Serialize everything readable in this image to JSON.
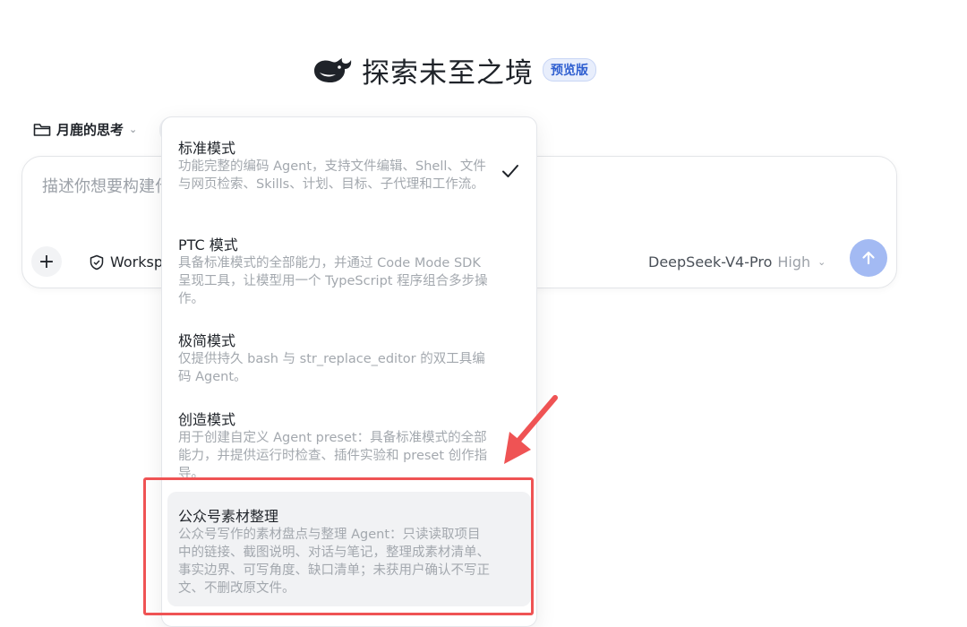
{
  "header": {
    "title": "探索未至之境",
    "badge": "预览版"
  },
  "folder": {
    "label": "月鹿的思考"
  },
  "input": {
    "placeholder": "描述你想要构建什么"
  },
  "toolbar": {
    "workspace_label": "Workspace",
    "model_name": "DeepSeek-V4-Pro",
    "model_level": "High"
  },
  "dropdown": {
    "options": [
      {
        "title": "标准模式",
        "desc": "功能完整的编码 Agent，支持文件编辑、Shell、文件与网页检索、Skills、计划、目标、子代理和工作流。",
        "selected_check": true
      },
      {
        "title": "PTC 模式",
        "desc": "具备标准模式的全部能力，并通过 Code Mode SDK 呈现工具，让模型用一个 TypeScript 程序组合多步操作。"
      },
      {
        "title": "极简模式",
        "desc": "仅提供持久 bash 与 str_replace_editor 的双工具编码 Agent。"
      },
      {
        "title": "创造模式",
        "desc": "用于创建自定义 Agent preset：具备标准模式的全部能力，并提供运行时检查、插件实验和 preset 创作指导。"
      },
      {
        "title": "公众号素材整理",
        "desc": "公众号写作的素材盘点与整理 Agent：只读读取项目中的链接、截图说明、对话与笔记，整理成素材清单、事实边界、可写角度、缺口清单；未获用户确认不写正文、不删改原文件。",
        "hovered": true
      }
    ]
  },
  "colors": {
    "accent": "#a3baf3",
    "annotation": "#ef5354",
    "badge_bg": "#e8eefc",
    "badge_text": "#2f5fd0"
  },
  "icons": [
    "whale-logo-icon",
    "folder-icon",
    "chevron-down-icon",
    "plus-icon",
    "shield-icon",
    "arrow-up-icon",
    "check-icon"
  ]
}
